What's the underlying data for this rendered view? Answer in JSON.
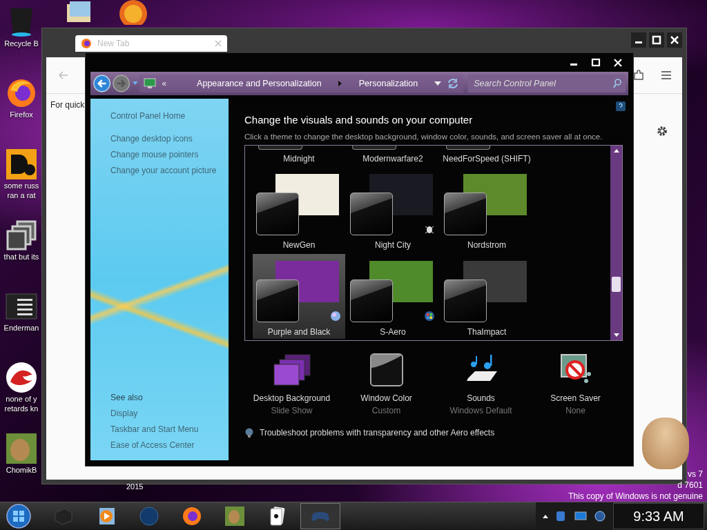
{
  "desktop": {
    "top_icons": [
      {
        "kind": "mail"
      },
      {
        "kind": "p-logo"
      }
    ],
    "icons": [
      {
        "kind": "recycle-bin",
        "lines": [
          "Recycle B"
        ]
      },
      {
        "kind": "firefox",
        "lines": [
          "Firefox"
        ]
      },
      {
        "kind": "orange-tile",
        "lines": [
          "some russ",
          "ran a rat"
        ]
      },
      {
        "kind": "stacked-windows",
        "lines": [
          "that but its"
        ]
      },
      {
        "kind": "terminal",
        "lines": [
          "Enderman"
        ]
      },
      {
        "kind": "red-dino",
        "lines": [
          "none of y",
          "retards kn"
        ]
      },
      {
        "kind": "hamster-tile",
        "lines": [
          "ChomikB"
        ]
      }
    ],
    "year_text": "2015",
    "watermark": [
      "vs 7",
      "d 7601",
      "This copy of Windows is not genuine"
    ]
  },
  "browser": {
    "tab": {
      "title": "New Tab"
    },
    "text": "For quick"
  },
  "control_panel": {
    "breadcrumb": {
      "overflow": "«",
      "crumbs": [
        "Appearance and Personalization",
        "Personalization"
      ]
    },
    "search": {
      "placeholder": "Search Control Panel"
    },
    "sidebar": {
      "links": [
        "Control Panel Home",
        "Change desktop icons",
        "Change mouse pointers",
        "Change your account picture"
      ],
      "see_also": {
        "title": "See also",
        "links": [
          "Display",
          "Taskbar and Start Menu",
          "Ease of Access Center"
        ]
      }
    },
    "title": "Change the visuals and sounds on your computer",
    "subtitle": "Click a theme to change the desktop background, window color, sounds, and screen saver all at once.",
    "themes": [
      {
        "name": "Midnight",
        "partial": true,
        "selected": false
      },
      {
        "name": "Modernwarfare2",
        "partial": true,
        "selected": false
      },
      {
        "name": "NeedForSpeed (SHIFT)",
        "partial": true,
        "selected": false
      },
      {
        "name": "NewGen",
        "partial": false,
        "selected": false,
        "kind": "plain"
      },
      {
        "name": "Night City",
        "partial": false,
        "selected": false,
        "kind": "bug"
      },
      {
        "name": "Nordstrom",
        "partial": false,
        "selected": false,
        "kind": "plain"
      },
      {
        "name": "Purple and Black",
        "partial": false,
        "selected": true,
        "kind": "orb"
      },
      {
        "name": "S-Aero",
        "partial": false,
        "selected": false,
        "kind": "flag"
      },
      {
        "name": "ThaImpact",
        "partial": false,
        "selected": false,
        "kind": "plain"
      }
    ],
    "settings": [
      {
        "kind": "background",
        "label": "Desktop Background",
        "value": "Slide Show"
      },
      {
        "kind": "window-color",
        "label": "Window Color",
        "value": "Custom"
      },
      {
        "kind": "sounds",
        "label": "Sounds",
        "value": "Windows Default"
      },
      {
        "kind": "screen-saver",
        "label": "Screen Saver",
        "value": "None"
      }
    ],
    "link": "Troubleshoot problems with transparency and other Aero effects"
  },
  "taskbar": {
    "apps": [
      {
        "kind": "dark-box",
        "active": false
      },
      {
        "kind": "media-player",
        "active": false
      },
      {
        "kind": "globe",
        "active": false
      },
      {
        "kind": "firefox",
        "active": false
      },
      {
        "kind": "hamster-tile",
        "active": false
      },
      {
        "kind": "cards",
        "active": false
      },
      {
        "kind": "controller",
        "active": true
      }
    ],
    "tray": [
      {
        "kind": "network"
      },
      {
        "kind": "monitor"
      },
      {
        "kind": "volume"
      }
    ],
    "clock": "9:33 AM"
  }
}
